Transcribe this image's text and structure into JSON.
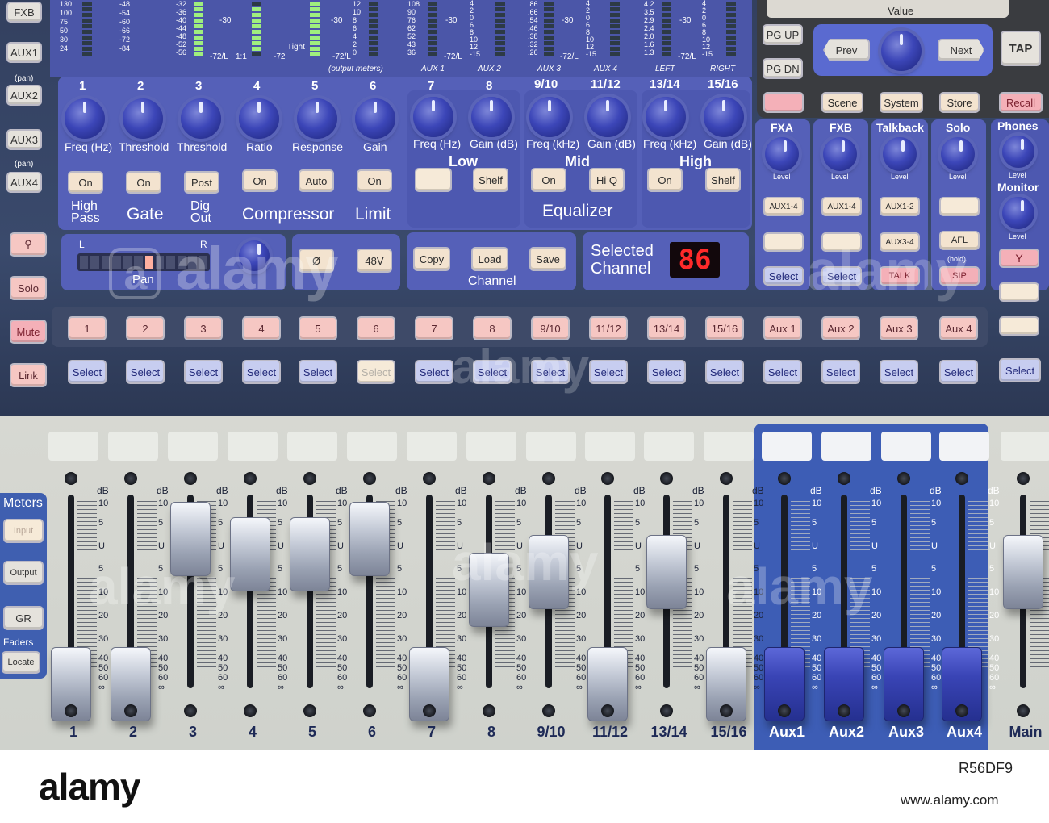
{
  "top": {
    "left_buttons": [
      "FXB",
      "AUX1",
      "(pan)",
      "AUX2",
      "AUX3",
      "(pan)",
      "AUX4"
    ],
    "left_lower_buttons": [
      "Solo",
      "Mute",
      "Link"
    ],
    "meter_scale_a": [
      "130",
      "100",
      "75",
      "50",
      "30",
      "24"
    ],
    "meter_scale_b": [
      "-48",
      "-54",
      "-60",
      "-66",
      "-72",
      "-84"
    ],
    "meter_scale_c": [
      "-32",
      "-36",
      "-40",
      "-44",
      "-48",
      "-52",
      "-56"
    ],
    "meter_marks": [
      "-30",
      "-72/L",
      "1:1",
      "-72",
      "Tight",
      "-30",
      "-72/L",
      "-30",
      "-72/L",
      "-30",
      "-72/L",
      "-30",
      "-72/L"
    ],
    "gr_scale": [
      "12",
      "10",
      "8",
      "6",
      "4",
      "2",
      "0"
    ],
    "output_meters_label": "(output meters)",
    "out_scale_1": [
      "108",
      "90",
      "76",
      "62",
      "52",
      "43",
      "36"
    ],
    "out_scale_2": [
      "4",
      "2",
      "0",
      "6",
      "8",
      "10",
      "12",
      "-15"
    ],
    "out_scale_3": [
      ".86",
      ".66",
      ".54",
      ".46",
      ".38",
      ".32",
      ".26"
    ],
    "out_scale_4": [
      "4",
      "2",
      "0",
      "6",
      "8",
      "10",
      "12",
      "-15"
    ],
    "out_scale_5": [
      "4.2",
      "3.5",
      "2.9",
      "2.4",
      "2.0",
      "1.6",
      "1.3"
    ],
    "out_scale_6": [
      "4",
      "2",
      "0",
      "6",
      "8",
      "10",
      "12",
      "-15"
    ],
    "out_labels": [
      "AUX 1",
      "AUX 2",
      "AUX 3",
      "AUX 4",
      "LEFT",
      "RIGHT"
    ],
    "channel_numbers": [
      "1",
      "2",
      "3",
      "4",
      "5",
      "6",
      "7",
      "8",
      "9/10",
      "11/12",
      "13/14",
      "15/16"
    ],
    "knob_labels": [
      "Freq (Hz)",
      "Threshold",
      "Threshold",
      "Ratio",
      "Response",
      "Gain",
      "Freq (Hz)",
      "Gain (dB)",
      "Freq (kHz)",
      "Gain (dB)",
      "Freq (kHz)",
      "Gain (dB)"
    ],
    "section_buttons": [
      "On",
      "On",
      "Post",
      "On",
      "Auto",
      "On",
      "",
      "Shelf",
      "On",
      "Hi Q",
      "On",
      "Shelf"
    ],
    "eq_band_labels": [
      "Low",
      "Mid",
      "High"
    ],
    "section_titles": [
      "High Pass",
      "Gate",
      "Dig Out",
      "Compressor",
      "Limit",
      "Equalizer"
    ],
    "pan": {
      "left": "L",
      "right": "R",
      "label": "Pan"
    },
    "phase_button": "Ø",
    "phantom_button": "48V",
    "channel_buttons": [
      "Copy",
      "Load",
      "Save"
    ],
    "channel_label": "Channel",
    "selected_channel_label": "Selected Channel",
    "display_value": "86",
    "value_label": "Value",
    "nav_buttons": [
      "PG UP",
      "PG DN",
      "Prev",
      "Next",
      "TAP"
    ],
    "system_buttons": [
      "",
      "Scene",
      "System",
      "Store",
      "Recall"
    ],
    "right_knobs": [
      "FXA",
      "FXB",
      "Talkback",
      "Solo",
      "Phones",
      "Monitor"
    ],
    "level_label": "Level",
    "right_col_buttons": [
      [
        "AUX1-4",
        "",
        "Select"
      ],
      [
        "AUX1-4",
        "",
        "Select"
      ],
      [
        "AUX1-2",
        "AUX3-4",
        "TALK"
      ],
      [
        "",
        "AFL",
        "SIP"
      ]
    ],
    "hold_label": "(hold)",
    "main_row_buttons": [
      "1",
      "2",
      "3",
      "4",
      "5",
      "6",
      "7",
      "8",
      "9/10",
      "11/12",
      "13/14",
      "15/16",
      "Aux 1",
      "Aux 2",
      "Aux 3",
      "Aux 4"
    ],
    "select_label": "Select",
    "select_count": 17
  },
  "bottom": {
    "meters_title": "Meters",
    "meter_buttons": [
      "Input",
      "Output",
      "GR"
    ],
    "faders_title": "Faders",
    "locate_button": "Locate",
    "db_label": "dB",
    "db_scale": [
      "10",
      "5",
      "U",
      "5",
      "10",
      "20",
      "30",
      "40",
      "50",
      "60",
      "∞"
    ],
    "fader_labels": [
      "1",
      "2",
      "3",
      "4",
      "5",
      "6",
      "7",
      "8",
      "9/10",
      "11/12",
      "13/14",
      "15/16",
      "Aux1",
      "Aux2",
      "Aux3",
      "Aux4",
      "Main"
    ],
    "fader_levels_db": [
      "-40",
      "-40",
      "5",
      "0",
      "0",
      "5",
      "-40",
      "-10",
      "-5",
      "-40",
      "-5",
      "-40",
      "-40",
      "-40",
      "-40",
      "-40",
      "-5"
    ]
  },
  "watermark": {
    "brand": "alamy",
    "url": "www.alamy.com",
    "image_id": "R56DF9",
    "mark": "a"
  },
  "colors": {
    "panel_blue": "#5560b8",
    "dark_frame": "#33405f",
    "button_cream": "#f3e3cf",
    "select_blue": "#c7cdf0",
    "aux_strip": "#3d5db5",
    "meter_green": "#9fef7e",
    "display_red": "#ff2a2a"
  }
}
